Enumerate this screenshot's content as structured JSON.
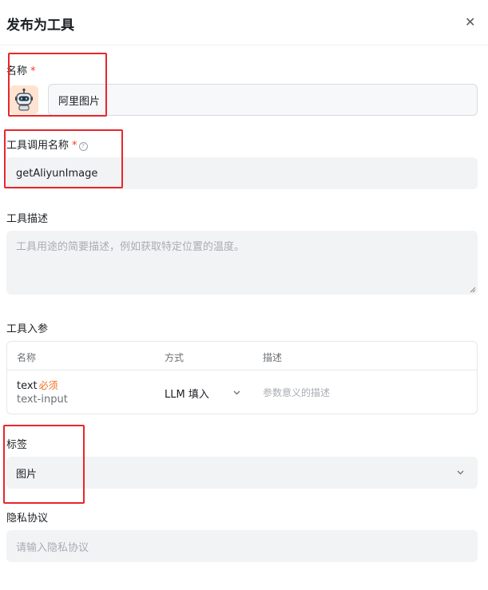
{
  "dialog": {
    "title": "发布为工具"
  },
  "name_field": {
    "label": "名称",
    "required_mark": "*",
    "value": "阿里图片"
  },
  "call_name_field": {
    "label": "工具调用名称",
    "required_mark": "*",
    "value": "getAliyunImage"
  },
  "description_field": {
    "label": "工具描述",
    "placeholder": "工具用途的简要描述，例如获取特定位置的温度。"
  },
  "params_section": {
    "label": "工具入参",
    "headers": [
      "名称",
      "方式",
      "描述"
    ],
    "rows": [
      {
        "name": "text",
        "required": "必须",
        "type": "text-input",
        "method": "LLM 填入",
        "desc_placeholder": "参数意义的描述"
      }
    ]
  },
  "tags_field": {
    "label": "标签",
    "value": "图片"
  },
  "privacy_field": {
    "label": "隐私协议",
    "placeholder": "请输入隐私协议"
  },
  "icons": {
    "close": "close-icon",
    "help": "help-circle-icon",
    "chevron": "chevron-down-icon",
    "avatar": "robot-avatar-icon"
  },
  "colors": {
    "required": "#f93920",
    "input_bg": "#f2f3f5",
    "annotation": "#e8262a",
    "tag_required": "#f06c1c"
  }
}
